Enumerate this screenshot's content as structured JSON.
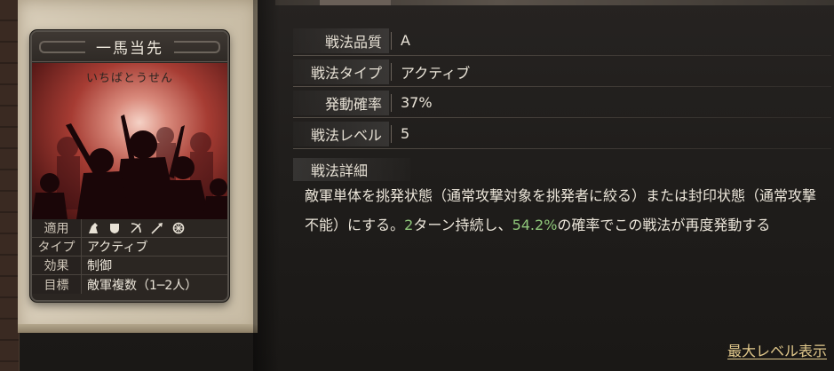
{
  "card": {
    "title": "一馬当先",
    "reading": "いちばとうせん",
    "apply_label": "適用",
    "apply_icons": [
      "cavalry-icon",
      "shield-icon",
      "bow-icon",
      "spear-icon",
      "wheel-icon"
    ],
    "type_label": "タイプ",
    "type_value": "アクティブ",
    "effect_label": "効果",
    "effect_value": "制御",
    "target_label": "目標",
    "target_value": "敵軍複数（1─2人）"
  },
  "details": [
    {
      "label": "戦法品質",
      "value": "A"
    },
    {
      "label": "戦法タイプ",
      "value": "アクティブ"
    },
    {
      "label": "発動確率",
      "value": "37%"
    },
    {
      "label": "戦法レベル",
      "value": "5"
    }
  ],
  "description": {
    "heading": "戦法詳細",
    "part1": "敵軍単体を挑発状態（通常攻撃対象を挑発者に絞る）または封印状態（通常攻撃不能）にする。",
    "highlight1": "2",
    "part2": "ターン持続し、",
    "highlight2": "54.2%",
    "part3": "の確率でこの戦法が再度発動する"
  },
  "max_level_link": "最大レベル表示",
  "colors": {
    "highlight": "#8fc77a",
    "link": "#e2c98c",
    "art_red": "#a63c33"
  }
}
